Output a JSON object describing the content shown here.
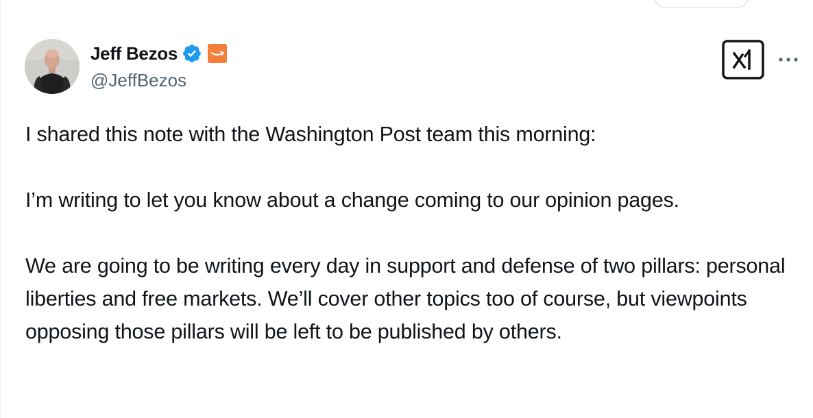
{
  "author": {
    "display_name": "Jeff Bezos",
    "handle": "@JeffBezos",
    "verified": true,
    "affiliate_badge_icon": "amazon-logo-icon"
  },
  "actions": {
    "grok_icon": "grok-icon",
    "more_icon": "more-options-icon"
  },
  "tweet": {
    "paragraphs": [
      "I shared this note with the Washington Post team this morning:",
      "I’m writing to let you know about a change coming to our opinion pages.",
      "We are going to be writing every day in support and defense of two pillars: personal liberties and free markets. We’ll cover other topics too of course, but viewpoints opposing those pillars will be left to be published by others."
    ]
  },
  "colors": {
    "text": "#0f1419",
    "secondary_text": "#536471",
    "verified_blue": "#1d9bf0",
    "amazon_orange": "#ff9900"
  }
}
